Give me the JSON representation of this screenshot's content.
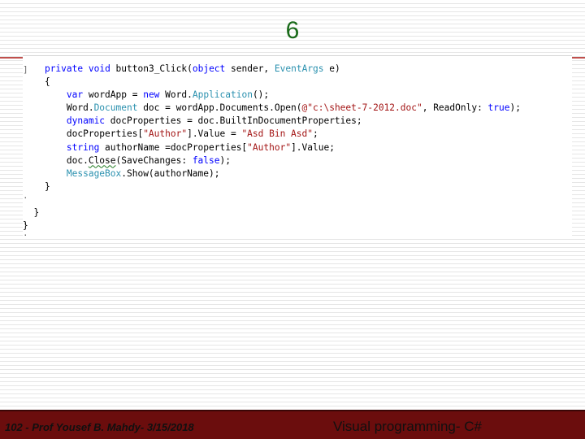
{
  "slide": {
    "title": "6"
  },
  "code": {
    "lines": [
      [
        {
          "t": "    ",
          "k": "pl"
        },
        {
          "t": "private",
          "k": "kw"
        },
        {
          "t": " ",
          "k": "pl"
        },
        {
          "t": "void",
          "k": "kw"
        },
        {
          "t": " button3_Click(",
          "k": "pl"
        },
        {
          "t": "object",
          "k": "kw"
        },
        {
          "t": " sender, ",
          "k": "pl"
        },
        {
          "t": "EventArgs",
          "k": "ty"
        },
        {
          "t": " e)",
          "k": "pl"
        }
      ],
      [
        {
          "t": "    {",
          "k": "pl"
        }
      ],
      [
        {
          "t": "        ",
          "k": "pl"
        },
        {
          "t": "var",
          "k": "kw"
        },
        {
          "t": " wordApp = ",
          "k": "pl"
        },
        {
          "t": "new",
          "k": "kw"
        },
        {
          "t": " Word.",
          "k": "pl"
        },
        {
          "t": "Application",
          "k": "ty"
        },
        {
          "t": "();",
          "k": "pl"
        }
      ],
      [
        {
          "t": "        Word.",
          "k": "pl"
        },
        {
          "t": "Document",
          "k": "ty"
        },
        {
          "t": " doc = wordApp.Documents.Open(",
          "k": "pl"
        },
        {
          "t": "@\"c:\\sheet-7-2012.doc\"",
          "k": "str"
        },
        {
          "t": ", ReadOnly: ",
          "k": "pl"
        },
        {
          "t": "true",
          "k": "kw"
        },
        {
          "t": ");",
          "k": "pl"
        }
      ],
      [
        {
          "t": "        ",
          "k": "pl"
        },
        {
          "t": "dynamic",
          "k": "kw"
        },
        {
          "t": " docProperties = doc.BuiltInDocumentProperties;",
          "k": "pl"
        }
      ],
      [
        {
          "t": "        docProperties[",
          "k": "pl"
        },
        {
          "t": "\"Author\"",
          "k": "str"
        },
        {
          "t": "].Value = ",
          "k": "pl"
        },
        {
          "t": "\"Asd Bin Asd\"",
          "k": "str"
        },
        {
          "t": ";",
          "k": "pl"
        }
      ],
      [
        {
          "t": "        ",
          "k": "pl"
        },
        {
          "t": "string",
          "k": "kw"
        },
        {
          "t": " authorName =docProperties[",
          "k": "pl"
        },
        {
          "t": "\"Author\"",
          "k": "str"
        },
        {
          "t": "].Value;",
          "k": "pl"
        }
      ],
      [
        {
          "t": "        doc.",
          "k": "pl"
        },
        {
          "t": "Close",
          "k": "sq"
        },
        {
          "t": "(SaveChanges: ",
          "k": "pl"
        },
        {
          "t": "false",
          "k": "kw"
        },
        {
          "t": ");",
          "k": "pl"
        }
      ],
      [
        {
          "t": "        ",
          "k": "pl"
        },
        {
          "t": "MessageBox",
          "k": "ty"
        },
        {
          "t": ".Show(authorName);",
          "k": "pl"
        }
      ],
      [
        {
          "t": "    }",
          "k": "pl"
        }
      ],
      [
        {
          "t": "",
          "k": "pl"
        }
      ],
      [
        {
          "t": "  }",
          "k": "pl"
        }
      ],
      [
        {
          "t": "}",
          "k": "pl"
        }
      ]
    ]
  },
  "footer": {
    "left_text": "102 - Prof Yousef B. Mahdy- 3/15/2018",
    "right_text": "Visual programming- C#"
  },
  "colors": {
    "keyword": "#0000ff",
    "type": "#2b91af",
    "string": "#a31515",
    "title": "#1a6b1a",
    "footer_bg": "#6b0d0d",
    "rule": "#c0504d"
  }
}
